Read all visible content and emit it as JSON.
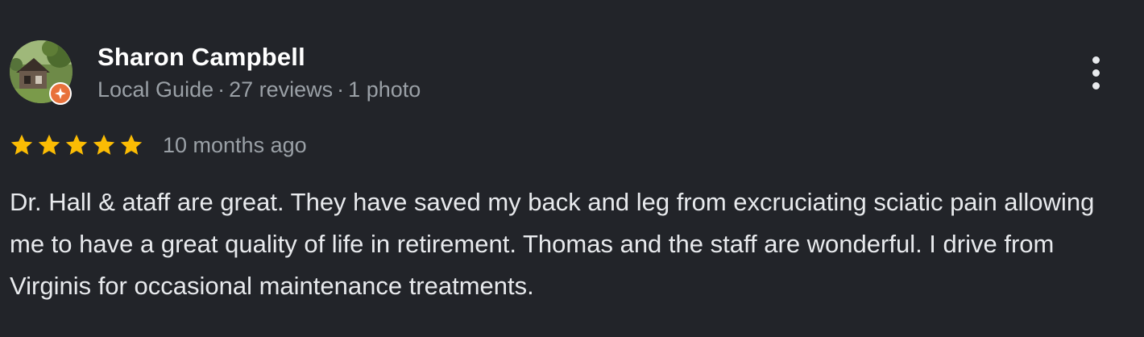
{
  "review": {
    "reviewer_name": "Sharon Campbell",
    "reviewer_level": "Local Guide",
    "separator": "·",
    "review_count": "27 reviews",
    "photo_count": "1 photo",
    "rating": 5,
    "max_rating": 5,
    "time_ago": "10 months ago",
    "text": "Dr. Hall & ataff are great. They have saved my back and leg from excruciating sciatic pain allowing me to have a great quality of life in retirement. Thomas and the staff are wonderful. I drive from Virginis for occasional maintenance treatments."
  },
  "icons": {
    "avatar": "avatar-photo",
    "badge": "local-guide-badge-icon",
    "star": "star-icon",
    "menu": "more-vert-icon"
  },
  "colors": {
    "background": "#222429",
    "star": "#fbbc04",
    "badge": "#e8713b",
    "primary_text": "#e8eaed",
    "secondary_text": "#9aa0a6"
  }
}
